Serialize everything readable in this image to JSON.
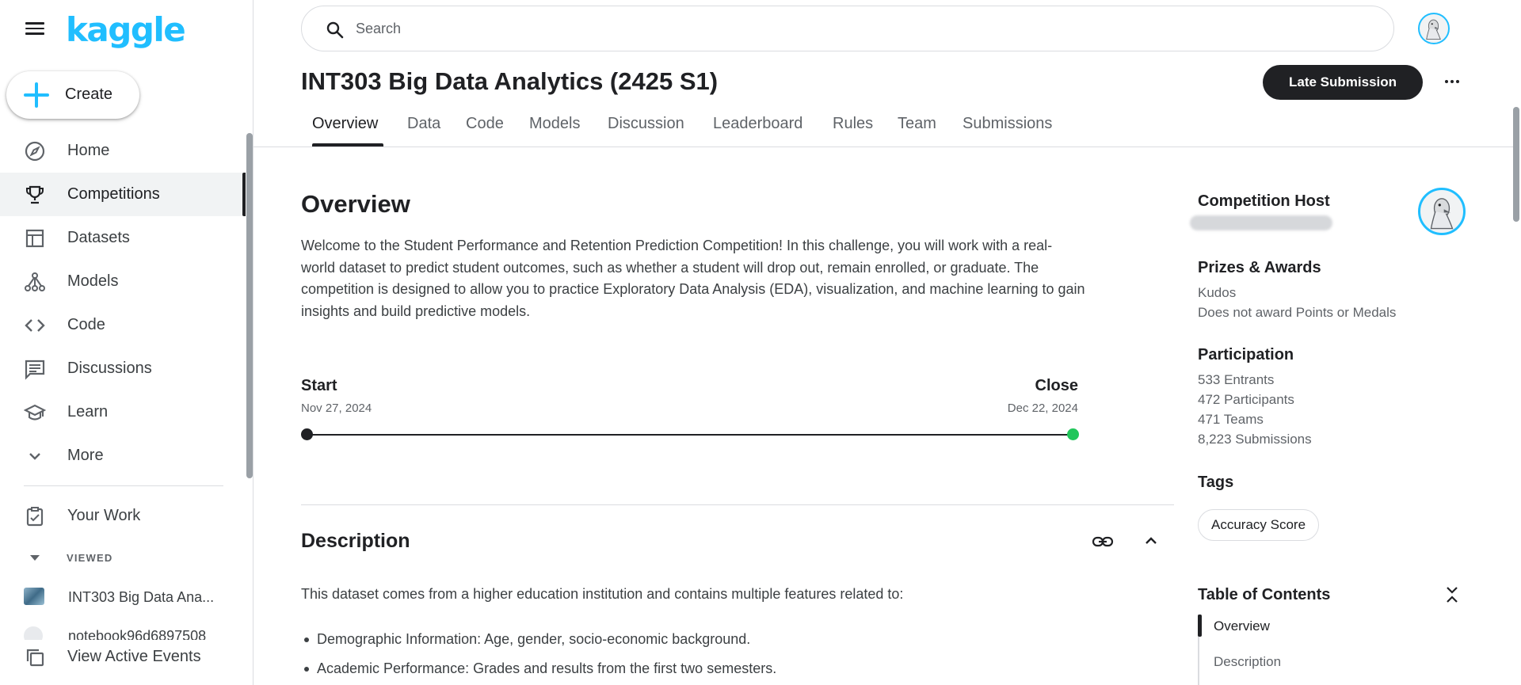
{
  "sidebar": {
    "logo": "kaggle",
    "create_label": "Create",
    "nav": [
      {
        "label": "Home",
        "icon": "compass-icon"
      },
      {
        "label": "Competitions",
        "icon": "trophy-icon",
        "active": true
      },
      {
        "label": "Datasets",
        "icon": "table-icon"
      },
      {
        "label": "Models",
        "icon": "models-icon"
      },
      {
        "label": "Code",
        "icon": "code-icon"
      },
      {
        "label": "Discussions",
        "icon": "discussion-icon"
      },
      {
        "label": "Learn",
        "icon": "school-icon"
      },
      {
        "label": "More",
        "icon": "chevron-down-icon"
      }
    ],
    "your_work": "Your Work",
    "viewed_label": "VIEWED",
    "viewed": [
      "INT303 Big Data Ana...",
      "notebook96d6897508"
    ],
    "view_active_events": "View Active Events"
  },
  "search": {
    "placeholder": "Search"
  },
  "header": {
    "title": "INT303 Big Data Analytics (2425 S1)",
    "late_submission": "Late Submission",
    "tabs": [
      "Overview",
      "Data",
      "Code",
      "Models",
      "Discussion",
      "Leaderboard",
      "Rules",
      "Team",
      "Submissions"
    ],
    "active_tab": "Overview"
  },
  "overview": {
    "heading": "Overview",
    "body": "Welcome to the Student Performance and Retention Prediction Competition! In this challenge, you will work with a real-world dataset to predict student outcomes, such as whether a student will drop out, remain enrolled, or graduate. The competition is designed to allow you to practice Exploratory Data Analysis (EDA), visualization, and machine learning to gain insights and build predictive models.",
    "start_label": "Start",
    "start_date": "Nov 27, 2024",
    "close_label": "Close",
    "close_date": "Dec 22, 2024"
  },
  "description": {
    "heading": "Description",
    "intro": "This dataset comes from a higher education institution and contains multiple features related to:",
    "bullets": [
      "Demographic Information: Age, gender, socio-economic background.",
      "Academic Performance: Grades and results from the first two semesters."
    ]
  },
  "right": {
    "host_heading": "Competition Host",
    "prizes_heading": "Prizes & Awards",
    "prizes": [
      "Kudos",
      "Does not award Points or Medals"
    ],
    "participation_heading": "Participation",
    "participation": [
      "533 Entrants",
      "472 Participants",
      "471 Teams",
      "8,223 Submissions"
    ],
    "tags_heading": "Tags",
    "tags": [
      "Accuracy Score"
    ],
    "toc_heading": "Table of Contents",
    "toc": [
      "Overview",
      "Description"
    ]
  },
  "colors": {
    "brand": "#20beff",
    "close_dot": "#20c65a",
    "primary_button": "#202124"
  }
}
